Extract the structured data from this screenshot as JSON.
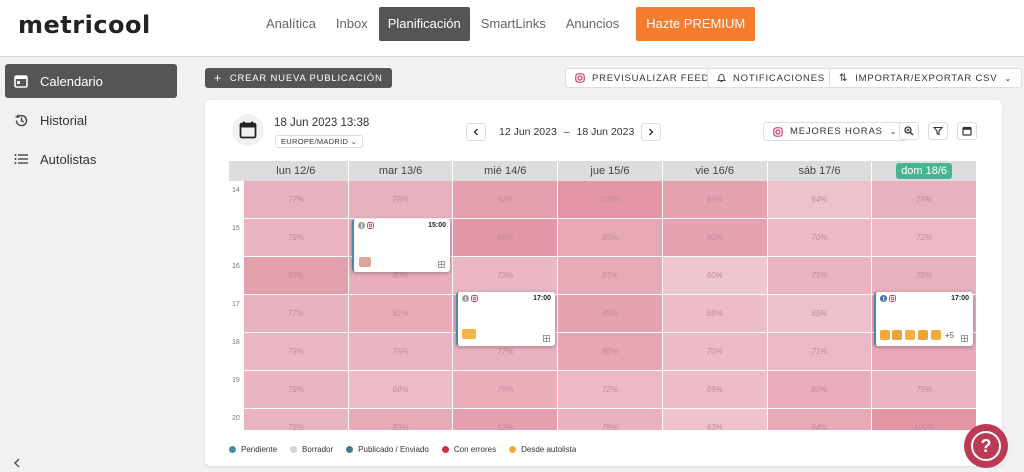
{
  "app": {
    "logo": "metricool"
  },
  "nav": {
    "items": [
      "Analítica",
      "Inbox",
      "Planificación",
      "SmartLinks",
      "Anuncios"
    ],
    "active_index": 2,
    "premium": "Hazte PREMIUM"
  },
  "sidebar": {
    "items": [
      {
        "label": "Calendario",
        "icon": "calendar-icon",
        "active": true
      },
      {
        "label": "Historial",
        "icon": "history-icon",
        "active": false
      },
      {
        "label": "Autolistas",
        "icon": "list-icon",
        "active": false
      }
    ],
    "collapse_icon": "chevron-left-icon"
  },
  "toolbar": {
    "create_label": "CREAR NUEVA PUBLICACIÓN",
    "preview_label": "PREVISUALIZAR FEED",
    "notifications_label": "NOTIFICACIONES",
    "import_export_label": "IMPORTAR/EXPORTAR CSV"
  },
  "calendar": {
    "datetime": "18 Jun 2023 13:38",
    "timezone": "EUROPE/MADRID",
    "range_start": "12 Jun 2023",
    "range_sep": "–",
    "range_end": "18 Jun 2023",
    "best_hours_label": "MEJORES HORAS",
    "days": [
      "lun 12/6",
      "mar 13/6",
      "mié 14/6",
      "jue 15/6",
      "vie 16/6",
      "sáb 17/6",
      "dom 18/6"
    ],
    "today_index": 6,
    "hours": [
      "14",
      "15",
      "16",
      "17",
      "18",
      "19",
      "20"
    ],
    "percentages": [
      [
        "77%",
        "78%",
        "92%",
        "100%",
        "89%",
        "64%",
        "78%"
      ],
      [
        "75%",
        "",
        "98%",
        "85%",
        "90%",
        "70%",
        "72%"
      ],
      [
        "93%",
        "80%",
        "73%",
        "83%",
        "60%",
        "75%",
        "78%"
      ],
      [
        "77%",
        "82%",
        "",
        "89%",
        "69%",
        "65%",
        ""
      ],
      [
        "73%",
        "75%",
        "77%",
        "86%",
        "70%",
        "71%",
        ""
      ],
      [
        "75%",
        "68%",
        "79%",
        "72%",
        "69%",
        "80%",
        "75%"
      ],
      [
        "76%",
        "83%",
        "92%",
        "78%",
        "63%",
        "84%",
        "100%"
      ]
    ]
  },
  "posts": [
    {
      "time": "15:00"
    },
    {
      "time": "17:00"
    },
    {
      "time": "17:00",
      "more": "+5"
    }
  ],
  "legend": [
    {
      "label": "Pendiente",
      "color": "#4a89a8"
    },
    {
      "label": "Borrador",
      "color": "#d5d5d5"
    },
    {
      "label": "Publicado / Enviado",
      "color": "#4a7a8c"
    },
    {
      "label": "Con errores",
      "color": "#d33048"
    },
    {
      "label": "Desde autolista",
      "color": "#f2a83b"
    }
  ],
  "colors": {
    "accent": "#f47c2d",
    "today": "#47b591",
    "help": "#bb3a56",
    "active": "#555555"
  }
}
